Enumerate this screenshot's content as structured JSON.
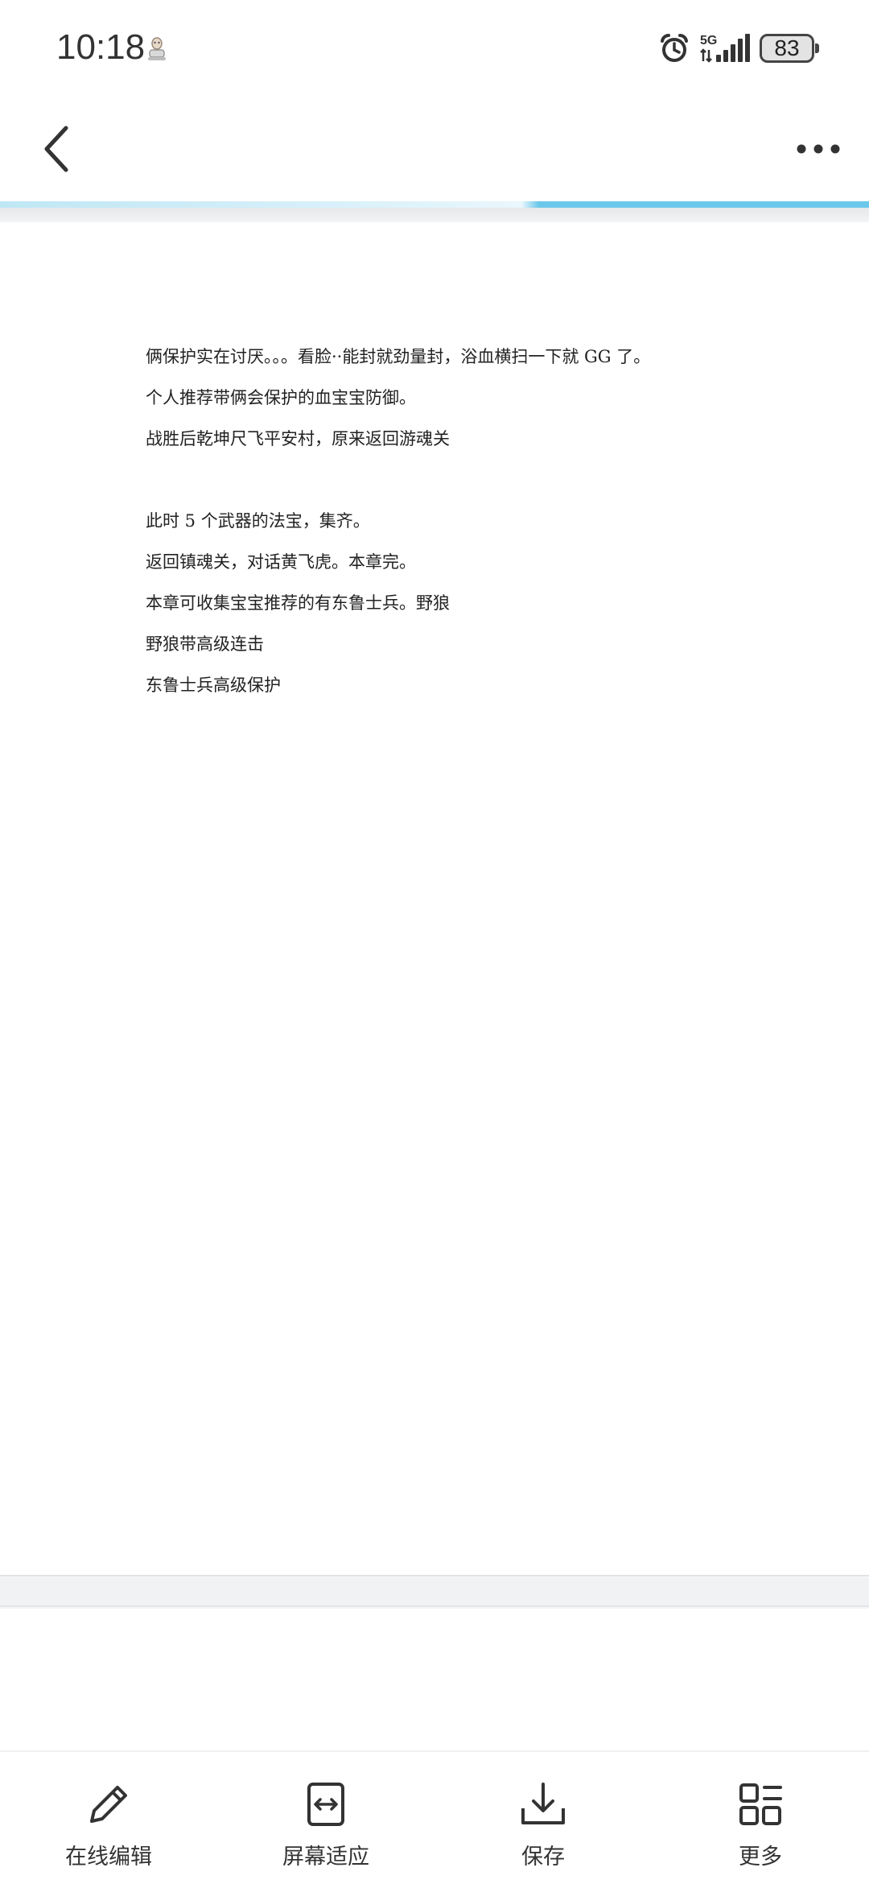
{
  "status_bar": {
    "time": "10:18",
    "network": "5G",
    "battery": "83"
  },
  "toolbar": {
    "back_icon": "chevron-left-icon",
    "more_icon": "more-dots-icon"
  },
  "document": {
    "lines": [
      "俩保护实在讨厌。。。看脸··能封就劲量封，浴血横扫一下就 GG 了。",
      "个人推荐带俩会保护的血宝宝防御。",
      "战胜后乾坤尺飞平安村，原来返回游魂关",
      "",
      "此时 5 个武器的法宝，集齐。",
      "返回镇魂关，对话黄飞虎。本章完。",
      "本章可收集宝宝推荐的有东鲁士兵。野狼",
      "野狼带高级连击",
      "东鲁士兵高级保护"
    ]
  },
  "bottom_bar": {
    "items": [
      {
        "label": "在线编辑",
        "icon": "pencil-icon"
      },
      {
        "label": "屏幕适应",
        "icon": "fit-screen-icon"
      },
      {
        "label": "保存",
        "icon": "download-icon"
      },
      {
        "label": "更多",
        "icon": "grid-more-icon"
      }
    ]
  },
  "colors": {
    "accent": "#6cc8ea",
    "icon": "#333333"
  }
}
